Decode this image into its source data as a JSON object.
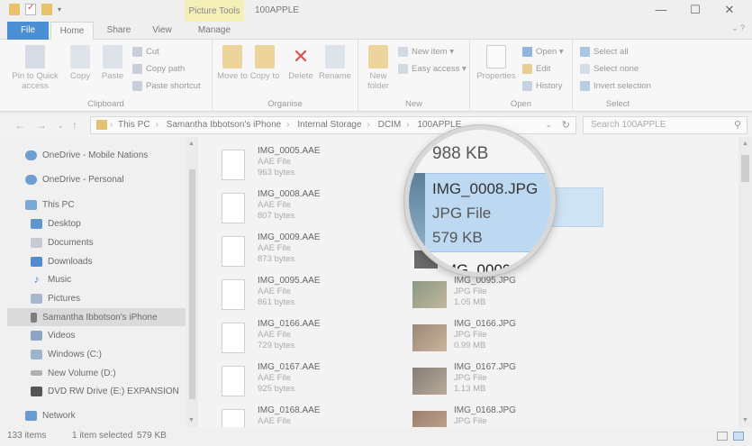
{
  "window": {
    "title": "100APPLE",
    "context_tab": "Picture Tools",
    "controls": [
      "—",
      "☐",
      "✕"
    ]
  },
  "ribbon_tabs": [
    {
      "label": "File"
    },
    {
      "label": "Home"
    },
    {
      "label": "Share"
    },
    {
      "label": "View"
    },
    {
      "label": "Manage"
    }
  ],
  "ribbon": {
    "clipboard": {
      "label": "Clipboard",
      "pin": "Pin to Quick access",
      "copy": "Copy",
      "paste": "Paste",
      "cut": "Cut",
      "copy_path": "Copy path",
      "paste_shortcut": "Paste shortcut"
    },
    "organise": {
      "label": "Organise",
      "move_to": "Move to",
      "copy_to": "Copy to",
      "delete": "Delete",
      "rename": "Rename"
    },
    "new": {
      "label": "New",
      "new_folder": "New folder",
      "new_item": "New item ▾",
      "easy_access": "Easy access ▾"
    },
    "open": {
      "label": "Open",
      "properties": "Properties",
      "open": "Open ▾",
      "edit": "Edit",
      "history": "History"
    },
    "select": {
      "label": "Select",
      "select_all": "Select all",
      "select_none": "Select none",
      "invert": "Invert selection"
    }
  },
  "address": {
    "crumbs": [
      "This PC",
      "Samantha Ibbotson's iPhone",
      "Internal Storage",
      "DCIM",
      "100APPLE"
    ],
    "search_placeholder": "Search 100APPLE"
  },
  "nav": {
    "items": [
      {
        "label": "OneDrive - Mobile Nations",
        "icon": "cloud-icon"
      },
      {
        "label": "OneDrive - Personal",
        "icon": "cloud-icon"
      },
      {
        "label": "This PC",
        "icon": "computer-icon"
      },
      {
        "label": "Desktop",
        "icon": "desktop-icon"
      },
      {
        "label": "Documents",
        "icon": "documents-icon"
      },
      {
        "label": "Downloads",
        "icon": "downloads-icon"
      },
      {
        "label": "Music",
        "icon": "music-icon"
      },
      {
        "label": "Pictures",
        "icon": "pictures-icon"
      },
      {
        "label": "Samantha Ibbotson's iPhone",
        "icon": "phone-icon"
      },
      {
        "label": "Videos",
        "icon": "videos-icon"
      },
      {
        "label": "Windows (C:)",
        "icon": "drive-icon"
      },
      {
        "label": "New Volume (D:)",
        "icon": "drive-icon"
      },
      {
        "label": "DVD RW Drive (E:) EXPANSION",
        "icon": "dvd-icon"
      },
      {
        "label": "Network",
        "icon": "network-icon"
      }
    ]
  },
  "files_left": [
    {
      "name": "IMG_0005.AAE",
      "type": "AAE File",
      "size": "963 bytes"
    },
    {
      "name": "IMG_0008.AAE",
      "type": "AAE File",
      "size": "807 bytes"
    },
    {
      "name": "IMG_0009.AAE",
      "type": "AAE File",
      "size": "873 bytes"
    },
    {
      "name": "IMG_0095.AAE",
      "type": "AAE File",
      "size": "861 bytes"
    },
    {
      "name": "IMG_0166.AAE",
      "type": "AAE File",
      "size": "729 bytes"
    },
    {
      "name": "IMG_0167.AAE",
      "type": "AAE File",
      "size": "925 bytes"
    },
    {
      "name": "IMG_0168.AAE",
      "type": "AAE File",
      "size": ""
    }
  ],
  "files_right": [
    {
      "name": "IMG_0095.JPG",
      "type": "JPG File",
      "size": "1.05 MB"
    },
    {
      "name": "IMG_0166.JPG",
      "type": "JPG File",
      "size": "0.99 MB"
    },
    {
      "name": "IMG_0167.JPG",
      "type": "JPG File",
      "size": "1.13 MB"
    },
    {
      "name": "IMG_0168.JPG",
      "type": "JPG File",
      "size": ""
    }
  ],
  "magnifier": {
    "top_size": "988 KB",
    "name": "IMG_0008.JPG",
    "type": "JPG File",
    "size": "579 KB",
    "next": "IMG_0009.J"
  },
  "status": {
    "count": "133 items",
    "selected": "1 item selected",
    "selected_size": "579 KB"
  }
}
